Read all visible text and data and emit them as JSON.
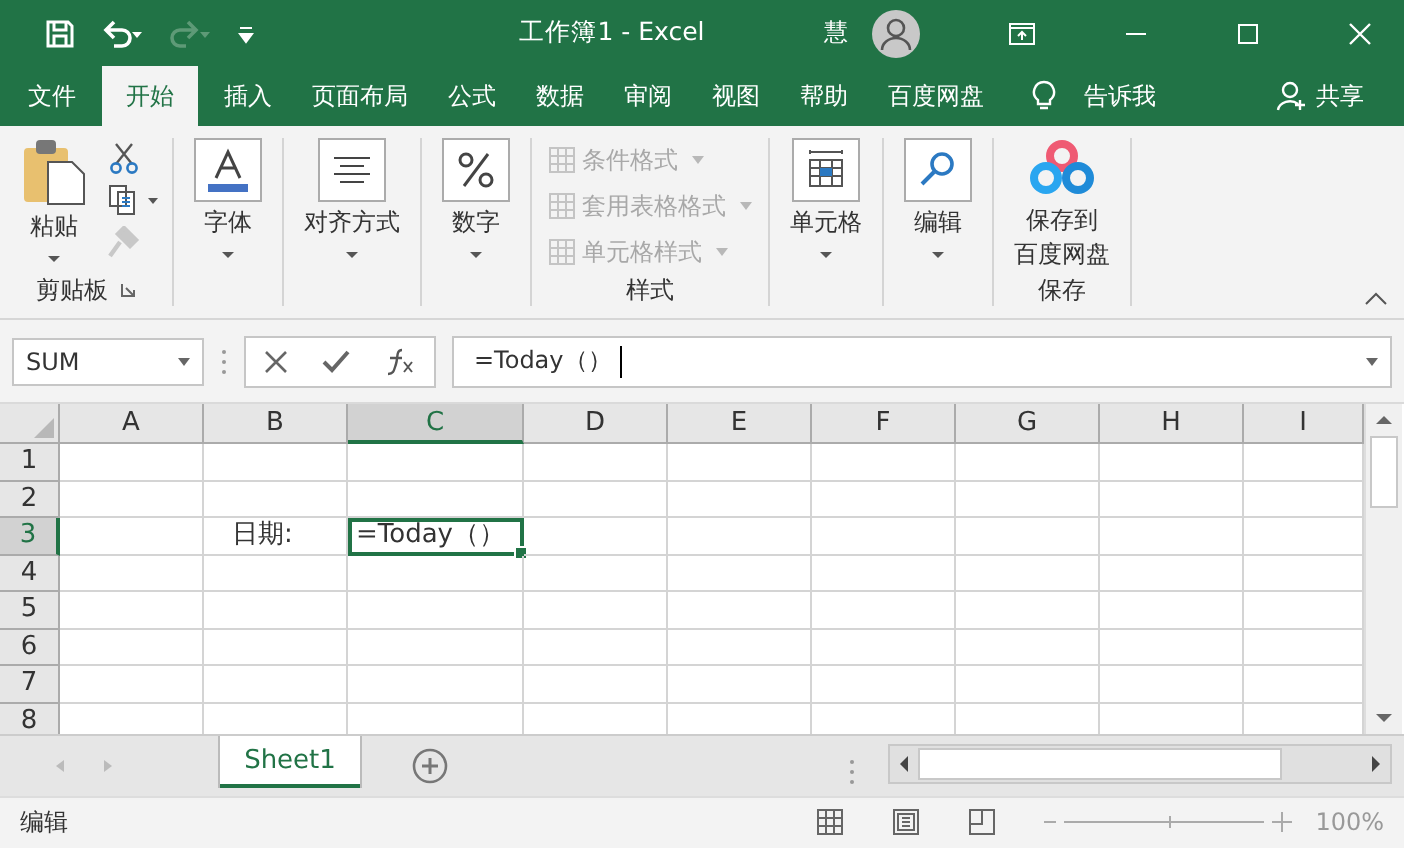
{
  "window": {
    "title": "工作簿1  -  Excel",
    "user_initial": "慧"
  },
  "ribbon_tabs": [
    {
      "label": "文件",
      "selected": false
    },
    {
      "label": "开始",
      "selected": true
    },
    {
      "label": "插入",
      "selected": false
    },
    {
      "label": "页面布局",
      "selected": false
    },
    {
      "label": "公式",
      "selected": false
    },
    {
      "label": "数据",
      "selected": false
    },
    {
      "label": "审阅",
      "selected": false
    },
    {
      "label": "视图",
      "selected": false
    },
    {
      "label": "帮助",
      "selected": false
    },
    {
      "label": "百度网盘",
      "selected": false
    }
  ],
  "tell_me": "告诉我",
  "share": "共享",
  "ribbon": {
    "groups": [
      {
        "kind": "clipboard",
        "button": "粘贴",
        "label": "剪贴板"
      },
      {
        "kind": "font",
        "button": "字体"
      },
      {
        "kind": "align",
        "button": "对齐方式"
      },
      {
        "kind": "number",
        "button": "数字"
      },
      {
        "kind": "styles",
        "label": "样式",
        "items": [
          {
            "label": "条件格式",
            "disabled": true
          },
          {
            "label": "套用表格格式",
            "disabled": true
          },
          {
            "label": "单元格样式",
            "disabled": true
          }
        ]
      },
      {
        "kind": "cells",
        "button": "单元格"
      },
      {
        "kind": "editing",
        "button": "编辑"
      },
      {
        "kind": "cloud",
        "button_lines": [
          "保存到",
          "百度网盘"
        ],
        "label": "保存"
      }
    ]
  },
  "name_box": "SUM",
  "formula": "=Today（）",
  "columns": [
    {
      "label": "A",
      "selected": false
    },
    {
      "label": "B",
      "selected": false
    },
    {
      "label": "C",
      "selected": true
    },
    {
      "label": "D",
      "selected": false
    },
    {
      "label": "E",
      "selected": false
    },
    {
      "label": "F",
      "selected": false
    },
    {
      "label": "G",
      "selected": false
    },
    {
      "label": "H",
      "selected": false
    },
    {
      "label": "I",
      "selected": false
    }
  ],
  "rows": [
    {
      "label": "1",
      "selected": false,
      "cells": [
        {
          "active": false
        },
        {
          "active": false
        },
        {
          "active": false
        },
        {
          "active": false
        },
        {
          "active": false
        },
        {
          "active": false
        },
        {
          "active": false
        },
        {
          "active": false
        },
        {
          "active": false
        }
      ]
    },
    {
      "label": "2",
      "selected": false,
      "cells": [
        {
          "active": false
        },
        {
          "active": false
        },
        {
          "active": false
        },
        {
          "active": false
        },
        {
          "active": false
        },
        {
          "active": false
        },
        {
          "active": false
        },
        {
          "active": false
        },
        {
          "active": false
        }
      ]
    },
    {
      "label": "3",
      "selected": true,
      "cells": [
        {
          "active": false
        },
        {
          "text": "日期:",
          "active": false
        },
        {
          "text": "=Today（）",
          "active": true
        },
        {
          "active": false
        },
        {
          "active": false
        },
        {
          "active": false
        },
        {
          "active": false
        },
        {
          "active": false
        },
        {
          "active": false
        }
      ]
    },
    {
      "label": "4",
      "selected": false,
      "cells": [
        {
          "active": false
        },
        {
          "active": false
        },
        {
          "active": false
        },
        {
          "active": false
        },
        {
          "active": false
        },
        {
          "active": false
        },
        {
          "active": false
        },
        {
          "active": false
        },
        {
          "active": false
        }
      ]
    },
    {
      "label": "5",
      "selected": false,
      "cells": [
        {
          "active": false
        },
        {
          "active": false
        },
        {
          "active": false
        },
        {
          "active": false
        },
        {
          "active": false
        },
        {
          "active": false
        },
        {
          "active": false
        },
        {
          "active": false
        },
        {
          "active": false
        }
      ]
    },
    {
      "label": "6",
      "selected": false,
      "cells": [
        {
          "active": false
        },
        {
          "active": false
        },
        {
          "active": false
        },
        {
          "active": false
        },
        {
          "active": false
        },
        {
          "active": false
        },
        {
          "active": false
        },
        {
          "active": false
        },
        {
          "active": false
        }
      ]
    },
    {
      "label": "7",
      "selected": false,
      "cells": [
        {
          "active": false
        },
        {
          "active": false
        },
        {
          "active": false
        },
        {
          "active": false
        },
        {
          "active": false
        },
        {
          "active": false
        },
        {
          "active": false
        },
        {
          "active": false
        },
        {
          "active": false
        }
      ]
    },
    {
      "label": "8",
      "selected": false,
      "cells": [
        {
          "active": false
        },
        {
          "active": false
        },
        {
          "active": false
        },
        {
          "active": false
        },
        {
          "active": false
        },
        {
          "active": false
        },
        {
          "active": false
        },
        {
          "active": false
        },
        {
          "active": false
        }
      ]
    }
  ],
  "sheets": [
    {
      "label": "Sheet1",
      "selected": true
    }
  ],
  "status": "编辑",
  "zoom": "100%"
}
